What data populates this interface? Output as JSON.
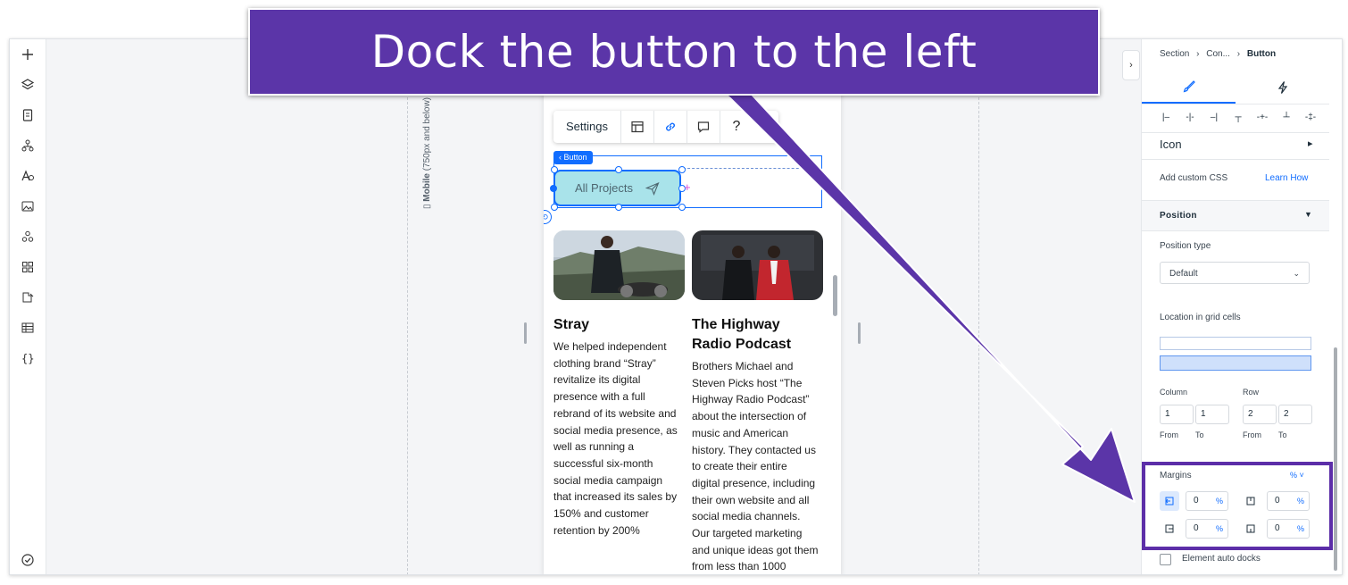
{
  "banner": {
    "text": "Dock the button to the left"
  },
  "canvas": {
    "breakpoint_label_bold": "Mobile",
    "breakpoint_label_rest": "(750px and below)"
  },
  "toolbar": {
    "settings_label": "Settings",
    "help_label": "?"
  },
  "selection": {
    "tag_label": "‹ Button",
    "button_label": "All Projects"
  },
  "cards": [
    {
      "title": "Stray",
      "body": [
        "We helped independent",
        "clothing brand “Stray”",
        "revitalize its digital",
        "presence with a full",
        "rebrand of its website and",
        "social media presence, as",
        "well as running a",
        "successful six-month",
        "social media campaign",
        "that increased its sales by",
        "150% and customer",
        "retention by 200%"
      ]
    },
    {
      "title": "The Highway Radio Podcast",
      "title_lines": [
        "The Highway",
        "Radio Podcast"
      ],
      "body": [
        "Brothers Michael and",
        "Steven Picks host “The",
        "Highway Radio Podcast”",
        "about the intersection of",
        "music and American",
        "history. They contacted us",
        "to create their entire",
        "digital presence, including",
        "their own website and all",
        "social media channels.",
        "Our targeted marketing",
        "and unique ideas got them",
        "from less than 1000"
      ]
    }
  ],
  "inspector": {
    "breadcrumb": {
      "first": "Section",
      "second": "Con...",
      "current": "Button"
    },
    "icon_row_label": "Icon",
    "custom_css_label": "Add custom CSS",
    "learn_how": "Learn How",
    "position_section": "Position",
    "position_type_label": "Position type",
    "position_type_value": "Default",
    "grid_cells_label": "Location in grid cells",
    "column_label": "Column",
    "row_label": "Row",
    "column_from": "1",
    "column_to": "1",
    "row_from": "2",
    "row_to": "2",
    "from_label": "From",
    "to_label": "To",
    "margins_label": "Margins",
    "margins_unit": "% ˅",
    "margin_left": "0",
    "margin_top": "0",
    "margin_right": "0",
    "margin_bottom": "0",
    "pct": "%",
    "auto_docks_label": "Element auto docks"
  },
  "colors": {
    "accent": "#116dff",
    "banner": "#5b35a8",
    "button_fill": "#a9e3ea"
  }
}
